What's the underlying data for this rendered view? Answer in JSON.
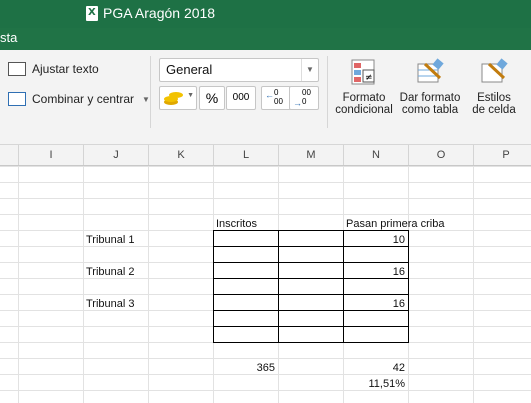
{
  "window": {
    "title": "PGA Aragón 2018",
    "tab_fragment": "sta"
  },
  "ribbon": {
    "wrap_text": "Ajustar texto",
    "merge_center": "Combinar y centrar",
    "number_format": "General",
    "percent": "%",
    "thousands": "000",
    "inc_decimal": "0\n00",
    "dec_decimal": "00\n0",
    "conditional_format": {
      "line1": "Formato",
      "line2": "condicional"
    },
    "format_table": {
      "line1": "Dar formato",
      "line2": "como tabla"
    },
    "cell_styles": {
      "line1": "Estilos",
      "line2": "de celda"
    }
  },
  "columns": [
    "I",
    "J",
    "K",
    "L",
    "M",
    "N",
    "O",
    "P"
  ],
  "sheet": {
    "header_inscritos": "Inscritos",
    "header_pasan": "Pasan primera criba",
    "rows": [
      {
        "label": "Tribunal 1",
        "value": "10"
      },
      {
        "label": "Tribunal 2",
        "value": "16"
      },
      {
        "label": "Tribunal 3",
        "value": "16"
      }
    ],
    "total_inscritos": "365",
    "total_pasan": "42",
    "percent": "11,51%"
  },
  "colors": {
    "excel_green": "#1e7145",
    "ribbon_bg": "#f3f3f3",
    "accent_blue": "#2f6fb3"
  }
}
